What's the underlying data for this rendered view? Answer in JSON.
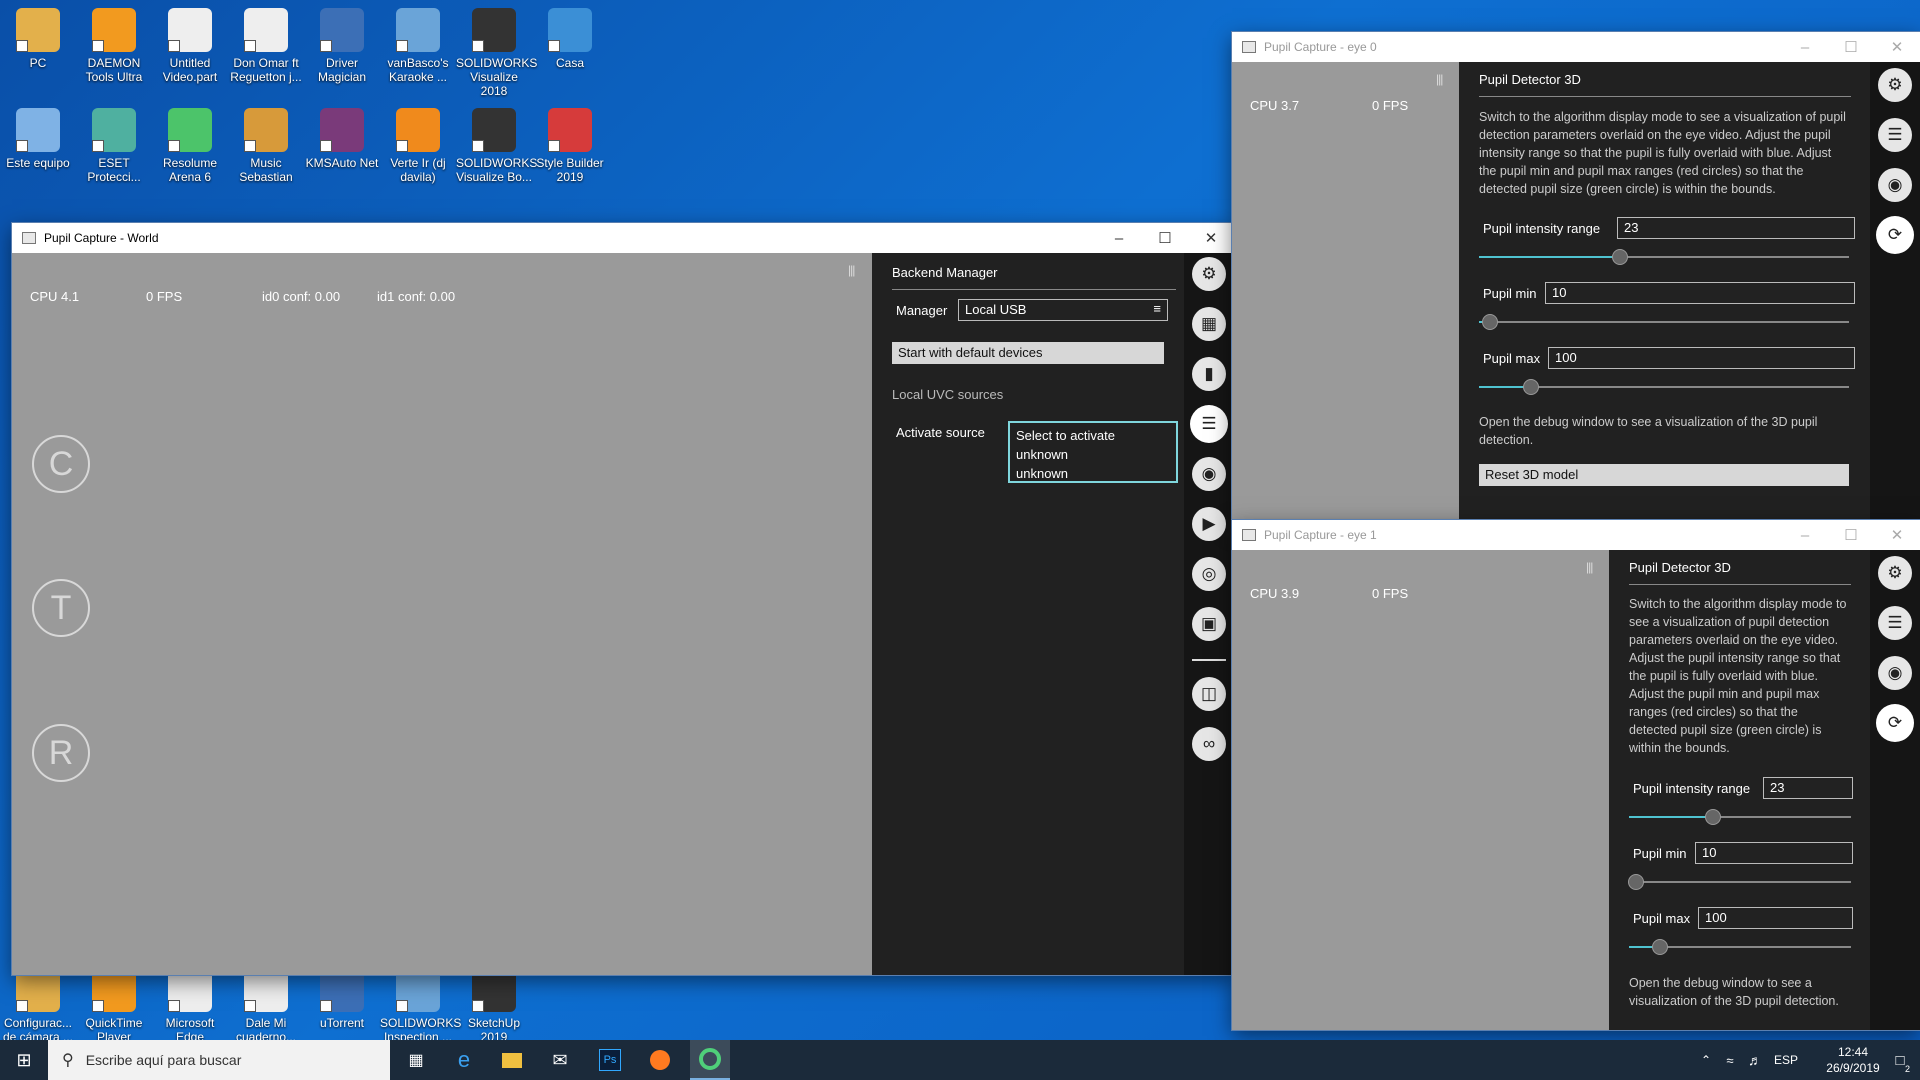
{
  "desktop": {
    "icons_row1": [
      "PC",
      "DAEMON Tools Ultra",
      "Untitled Video.part",
      "Don Omar ft Reguetton j...",
      "Driver Magician",
      "vanBasco's Karaoke ...",
      "SOLIDWORKS Visualize 2018",
      "Casa"
    ],
    "icons_row2": [
      "Este equipo",
      "ESET Protecci...",
      "Resolume Arena 6",
      "Music Sebastian",
      "KMSAuto Net",
      "Verte Ir (dj davila)",
      "SOLIDWORKS Visualize Bo...",
      "Style Builder 2019"
    ],
    "icons_bottom": [
      "Configurac... de cámara ...",
      "QuickTime Player",
      "Microsoft Edge",
      "Dale Mi cuaderno...",
      "uTorrent",
      "SOLIDWORKS Inspection ...",
      "SketchUp 2019"
    ],
    "colors": {
      "icon_tints": [
        "#e3b04b",
        "#f29a1f",
        "#eeeeee",
        "#eeeeee",
        "#3c6fb6",
        "#6aa4d8",
        "#333333",
        "#3b8fd6",
        "#7fb2e5",
        "#4fb0a0",
        "#4cc46a",
        "#d79a3a",
        "#7a3a7a",
        "#f08a1c",
        "#333333",
        "#d63b3b"
      ]
    }
  },
  "world": {
    "title": "Pupil Capture - World",
    "cpu": "CPU 4.1",
    "fps": "0 FPS",
    "id0": "id0 conf: 0.00",
    "id1": "id1 conf: 0.00",
    "big_buttons": [
      "C",
      "T",
      "R"
    ],
    "panel": {
      "title": "Backend Manager",
      "manager_label": "Manager",
      "manager_value": "Local USB",
      "start_button": "Start with default devices",
      "section": "Local UVC sources",
      "activate_label": "Activate source",
      "options": [
        "Select to activate",
        "unknown",
        "unknown"
      ]
    },
    "icons": [
      "gear-icon",
      "grid-icon",
      "bar-chart-icon",
      "list-icon",
      "camera-icon",
      "video-camera-icon",
      "record-icon",
      "focus-icon",
      "cast-icon",
      "link-icon"
    ]
  },
  "eye0": {
    "title": "Pupil Capture - eye 0",
    "cpu": "CPU 3.7",
    "fps": "0 FPS",
    "panel": {
      "title": "Pupil Detector 3D",
      "description": "Switch to the algorithm display mode to see a visualization of pupil detection parameters overlaid on the eye video. Adjust the pupil intensity range so that the pupil is fully overlaid with blue. Adjust the pupil min and pupil max ranges (red circles) so that the detected pupil size (green circle) is within the bounds.",
      "intensity_label": "Pupil intensity range",
      "intensity_value": "23",
      "intensity_fraction": 0.38,
      "min_label": "Pupil min",
      "min_value": "10",
      "min_fraction": 0.03,
      "max_label": "Pupil max",
      "max_value": "100",
      "max_fraction": 0.14,
      "debug_text": "Open the debug window to see a visualization of the 3D pupil detection.",
      "reset_button": "Reset 3D model"
    }
  },
  "eye1": {
    "title": "Pupil Capture - eye 1",
    "cpu": "CPU 3.9",
    "fps": "0 FPS",
    "panel": {
      "title": "Pupil Detector 3D",
      "description": "Switch to the algorithm display mode to see a visualization of pupil detection parameters overlaid on the eye video. Adjust the pupil intensity range so that the pupil is fully overlaid with blue. Adjust the pupil min and pupil max ranges (red circles) so that the detected pupil size (green circle) is within the bounds.",
      "intensity_label": "Pupil intensity range",
      "intensity_value": "23",
      "intensity_fraction": 0.38,
      "min_label": "Pupil min",
      "min_value": "10",
      "min_fraction": 0.03,
      "max_label": "Pupil max",
      "max_value": "100",
      "max_fraction": 0.14,
      "debug_text": "Open the debug window to see a visualization of the 3D pupil detection."
    }
  },
  "taskbar": {
    "search_placeholder": "Escribe aquí para buscar",
    "lang": "ESP",
    "time": "12:44",
    "date": "26/9/2019",
    "notifications": "2"
  }
}
